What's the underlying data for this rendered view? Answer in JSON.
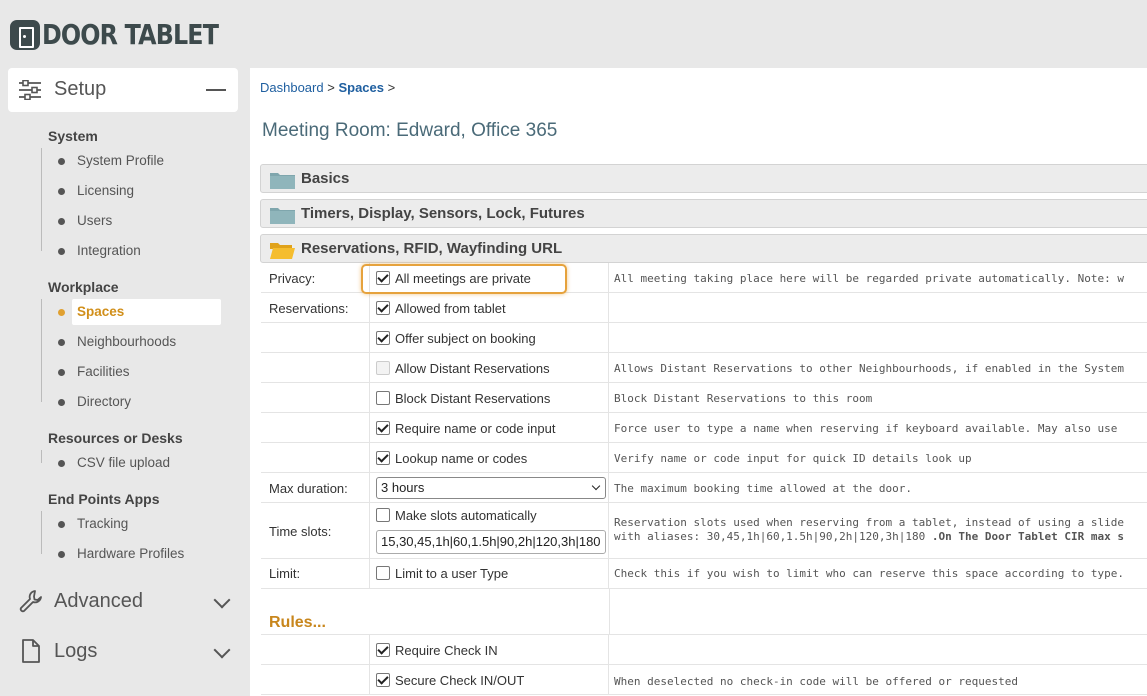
{
  "brand": {
    "name": "DOOR TABLET"
  },
  "sidebar": {
    "setup_label": "Setup",
    "groups": [
      {
        "title": "System",
        "items": [
          "System Profile",
          "Licensing",
          "Users",
          "Integration"
        ]
      },
      {
        "title": "Workplace",
        "items": [
          "Spaces",
          "Neighbourhoods",
          "Facilities",
          "Directory"
        ]
      },
      {
        "title": "Resources or Desks",
        "items": [
          "CSV file upload"
        ]
      },
      {
        "title": "End Points Apps",
        "items": [
          "Tracking",
          "Hardware Profiles"
        ]
      }
    ],
    "active_item": "Spaces",
    "advanced_label": "Advanced",
    "logs_label": "Logs"
  },
  "main": {
    "breadcrumb": {
      "dashboard": "Dashboard",
      "sep1": ">",
      "spaces": "Spaces",
      "sep2": ">"
    },
    "title": "Meeting Room: Edward, Office 365",
    "panels": [
      "Basics",
      "Timers, Display, Sensors, Lock, Futures",
      "Reservations, RFID, Wayfinding URL"
    ],
    "form": {
      "privacy_label": "Privacy:",
      "privacy_option": "All meetings are private",
      "privacy_hint": "All meeting taking place here will be regarded private automatically. Note: w",
      "reservations_label": "Reservations:",
      "allowed_from_tablet": "Allowed from tablet",
      "offer_subject": "Offer subject on booking",
      "allow_distant": "Allow Distant Reservations",
      "allow_distant_hint": "Allows Distant Reservations to other Neighbourhoods, if enabled in the System",
      "block_distant": "Block Distant Reservations",
      "block_distant_hint": "Block Distant Reservations to this room",
      "require_name": "Require name or code input",
      "require_name_hint": "Force user to type a name when reserving if keyboard available.  May also use",
      "lookup_name": "Lookup name or codes",
      "lookup_name_hint": "Verify name or code input for quick ID details look up",
      "max_duration_label": "Max duration:",
      "max_duration_value": "3 hours",
      "max_duration_hint": "The maximum booking time allowed at the door.",
      "time_slots_label": "Time slots:",
      "make_slots_auto": "Make slots automatically",
      "time_slots_value": "15,30,45,1h|60,1.5h|90,2h|120,3h|180",
      "time_slots_hint_1": "Reservation slots used when reserving from a tablet, instead of using a slide",
      "time_slots_hint_2a": "with aliases: 30,45,1h|60,1.5h|90,2h|120,3h|180 ",
      "time_slots_hint_2b": ".On The Door Tablet CIR max s",
      "limit_label": "Limit:",
      "limit_option": "Limit to a user Type",
      "limit_hint": "Check this if you wish to limit who can reserve this space according to type.",
      "rules_title": "Rules...",
      "require_checkin": "Require Check IN",
      "secure_checkin": "Secure Check IN/OUT",
      "secure_checkin_hint": "When deselected no check-in code will be offered or requested"
    }
  },
  "colors": {
    "accent": "#e6a23c",
    "link": "#1f5fa0",
    "folder": "#7fa6ad",
    "folder_open": "#f2b622"
  }
}
